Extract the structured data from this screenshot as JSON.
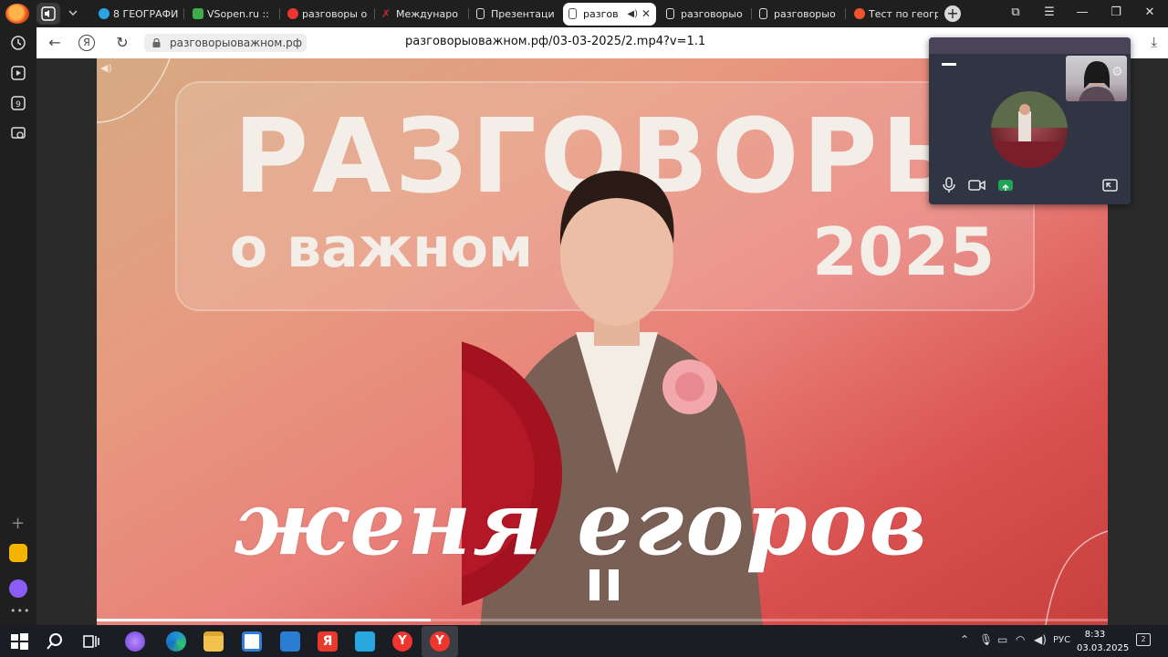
{
  "browser": {
    "tabs": [
      {
        "label": "8 ГЕОГРАФИ",
        "favicon_color": "#2aa3e0"
      },
      {
        "label": "VSopen.ru ::",
        "favicon_color": "#3fae49"
      },
      {
        "label": "разговоры о",
        "favicon_color": "#f0342e"
      },
      {
        "label": "Междунаро",
        "favicon_color": "#c62828"
      },
      {
        "label": "Презентаци",
        "favicon_color": "#ffffff"
      },
      {
        "label": "разгов",
        "favicon_color": "#ffffff",
        "active": true
      },
      {
        "label": "разговорыо",
        "favicon_color": "#ffffff"
      },
      {
        "label": "разговорыо",
        "favicon_color": "#ffffff"
      },
      {
        "label": "Тест по геогр",
        "favicon_color": "#f0532e"
      }
    ],
    "address": {
      "domain": "разговорыоважном.рф",
      "url": "разговорыоважном.рф/03-03-2025/2.mp4?v=1.1"
    }
  },
  "video": {
    "title_line1": "РАЗГОВОРЫ",
    "title_line2": "о важном",
    "year": "2025",
    "guest_name": "женя егоров",
    "playback_progress": 0.33,
    "state": "playing"
  },
  "taskbar": {
    "language": "РУС",
    "time": "8:33",
    "date": "03.03.2025",
    "notification_count": "2"
  },
  "colors": {
    "video_gradient_start": "#d6aa82",
    "video_gradient_end": "#c8403e",
    "active_tab": "#ffffff",
    "call_share_green": "#22a35a"
  }
}
